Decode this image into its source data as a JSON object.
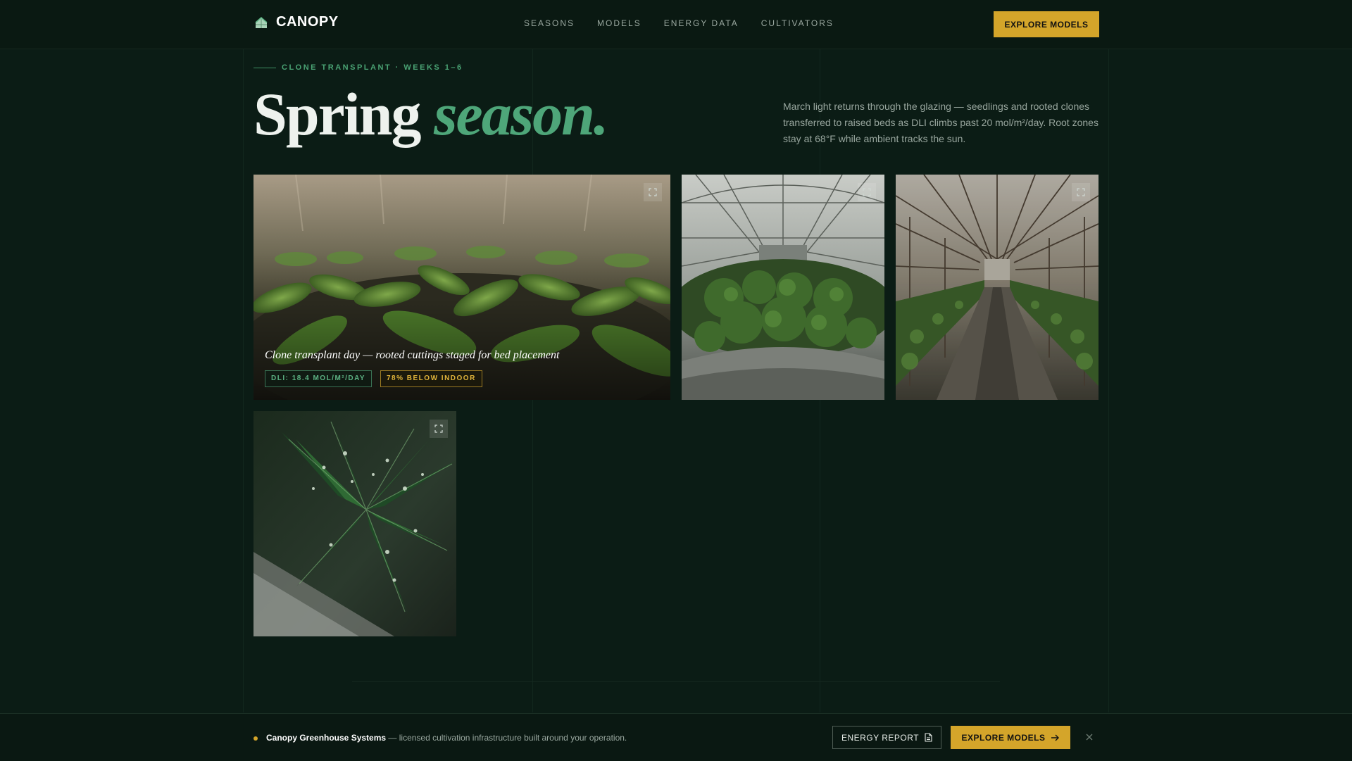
{
  "header": {
    "brand": "CANOPY",
    "nav": [
      "SEASONS",
      "MODELS",
      "ENERGY DATA",
      "CULTIVATORS"
    ],
    "cta_label": "EXPLORE MODELS"
  },
  "hero": {
    "eyebrow": "CLONE TRANSPLANT · WEEKS 1–6",
    "headline_main": "Spring",
    "headline_accent": "season.",
    "intro": "March light returns through the glazing — seedlings and rooted clones transferred to raised beds as DLI climbs past 20 mol/m²/day. Root zones stay at 68°F while ambient tracks the sun."
  },
  "gallery": {
    "featured": {
      "caption": "Clone transplant day — rooted cuttings staged for bed placement",
      "chip_dli": "DLI: 18.4 MOL/M²/DAY",
      "chip_energy": "78% BELOW INDOOR"
    }
  },
  "footer": {
    "company": "Canopy Greenhouse Systems",
    "tagline": " — licensed cultivation infrastructure built around your operation.",
    "report_label": "ENERGY REPORT",
    "explore_label": "EXPLORE MODELS"
  },
  "colors": {
    "background": "#0b1c15",
    "accent_green": "#4ea679",
    "accent_gold": "#d4a52a"
  }
}
